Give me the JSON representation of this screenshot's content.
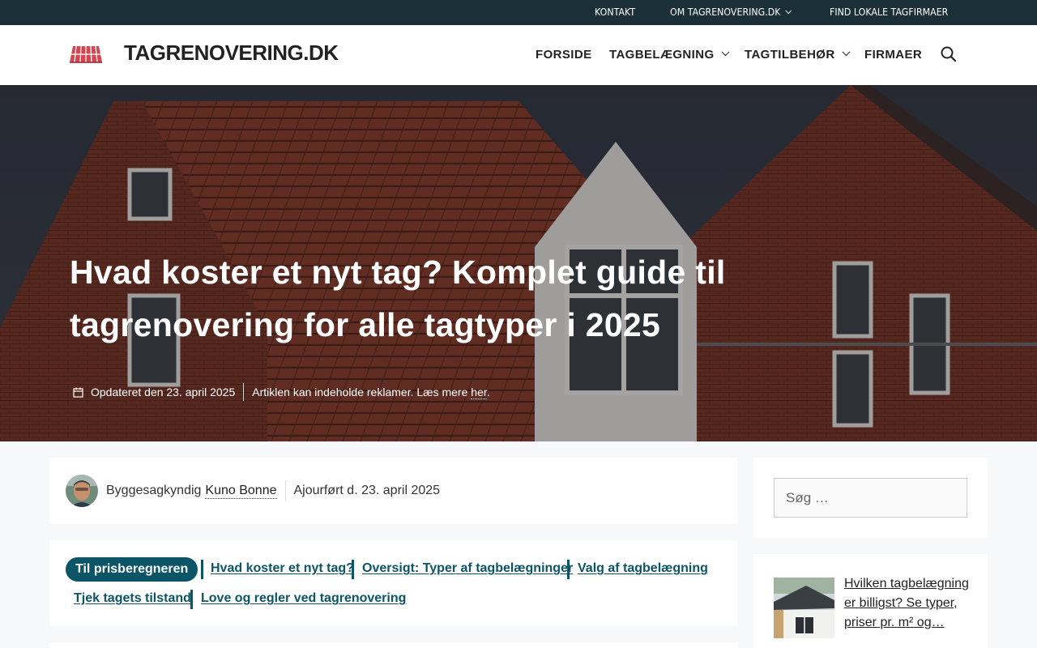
{
  "topbar": {
    "links": [
      {
        "label": "KONTAKT"
      },
      {
        "label": "OM TAGRENOVERING.DK",
        "dropdown": true
      },
      {
        "label": "FIND LOKALE TAGFIRMAER"
      }
    ],
    "background": "#1b2f38"
  },
  "header": {
    "site_title": "TAGRENOVERING.DK",
    "logo_icon": "roof-tiles-icon",
    "nav": [
      {
        "label": "FORSIDE"
      },
      {
        "label": "TAGBELÆGNING",
        "dropdown": true
      },
      {
        "label": "TAGTILBEHØR",
        "dropdown": true
      },
      {
        "label": "FIRMAER"
      }
    ],
    "search_icon": "search-icon"
  },
  "hero": {
    "title": "Hvad koster et nyt tag? Komplet guide til tagrenovering for alle tagtyper i 2025",
    "updated": "Opdateret den 23. april 2025",
    "ad_notice_prefix": "Artiklen kan indeholde reklamer. Læs mere ",
    "ad_notice_link": "her",
    "ad_notice_suffix": "."
  },
  "author": {
    "role": "Byggesagkyndig",
    "name": "Kuno Bonne",
    "updated": "Ajourført d. 23. april 2025"
  },
  "toc": {
    "primary": "Til prisberegneren",
    "links": [
      "Hvad koster et nyt tag?",
      "Oversigt: Typer af tagbelægninger",
      "Valg af tagbelægning",
      "Tjek tagets tilstand",
      "Love og regler ved tagrenovering"
    ],
    "accent": "#0c5468"
  },
  "sidebar": {
    "search_placeholder": "Søg …",
    "related_title": "Hvilken tagbelægning er billigst? Se typer, priser pr. m² og…"
  }
}
